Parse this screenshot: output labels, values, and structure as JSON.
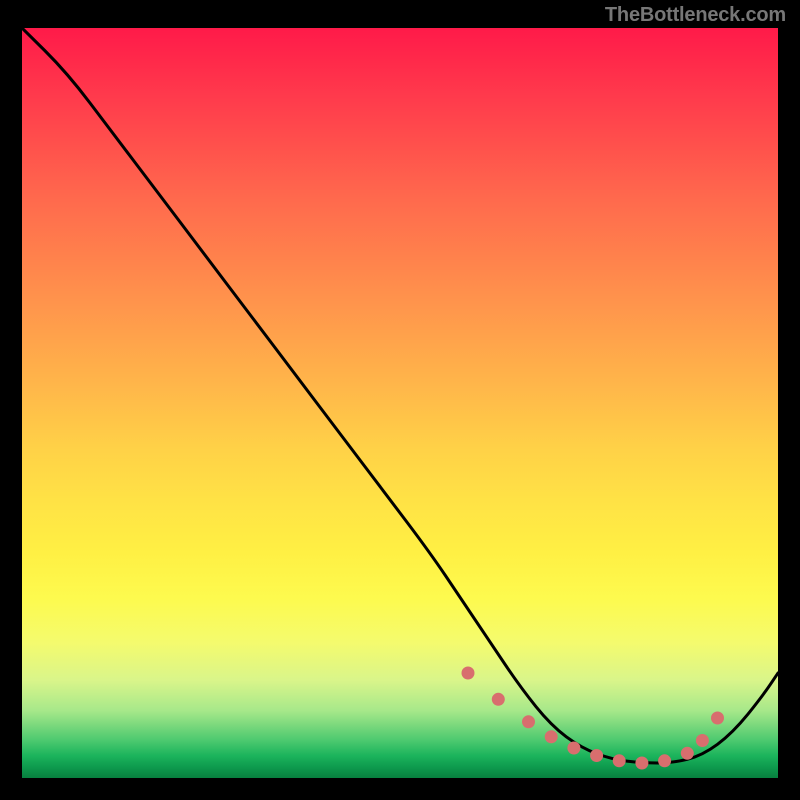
{
  "watermark": "TheBottleneck.com",
  "chart_data": {
    "type": "line",
    "title": "",
    "xlabel": "",
    "ylabel": "",
    "xlim": [
      0,
      100
    ],
    "ylim": [
      0,
      100
    ],
    "x": [
      0,
      6,
      12,
      18,
      24,
      30,
      36,
      42,
      48,
      54,
      58,
      62,
      66,
      70,
      74,
      78,
      82,
      86,
      90,
      94,
      98,
      100
    ],
    "values": [
      100,
      94,
      86,
      78,
      70,
      62,
      54,
      46,
      38,
      30,
      24,
      18,
      12,
      7,
      4,
      2.5,
      2,
      2,
      3,
      6,
      11,
      14
    ],
    "markers": {
      "x": [
        59,
        63,
        67,
        70,
        73,
        76,
        79,
        82,
        85,
        88,
        90,
        92
      ],
      "y": [
        14,
        10.5,
        7.5,
        5.5,
        4,
        3,
        2.3,
        2,
        2.3,
        3.3,
        5,
        8
      ]
    },
    "gradient_stops": [
      {
        "pct": 0,
        "color": "#ff1a49"
      },
      {
        "pct": 10,
        "color": "#ff3d4c"
      },
      {
        "pct": 23,
        "color": "#ff6a4d"
      },
      {
        "pct": 35,
        "color": "#ff8f4c"
      },
      {
        "pct": 47,
        "color": "#ffb44a"
      },
      {
        "pct": 56,
        "color": "#ffd147"
      },
      {
        "pct": 63,
        "color": "#ffe245"
      },
      {
        "pct": 70,
        "color": "#fff044"
      },
      {
        "pct": 76,
        "color": "#fdfa4e"
      },
      {
        "pct": 82,
        "color": "#f4fb6e"
      },
      {
        "pct": 87,
        "color": "#d9f58a"
      },
      {
        "pct": 91,
        "color": "#a7e88a"
      },
      {
        "pct": 95,
        "color": "#4cc96f"
      },
      {
        "pct": 97,
        "color": "#1cb45c"
      },
      {
        "pct": 98.5,
        "color": "#0e9b4e"
      },
      {
        "pct": 100,
        "color": "#08803f"
      }
    ],
    "marker_color": "#d86e6e",
    "line_color": "#000000"
  }
}
